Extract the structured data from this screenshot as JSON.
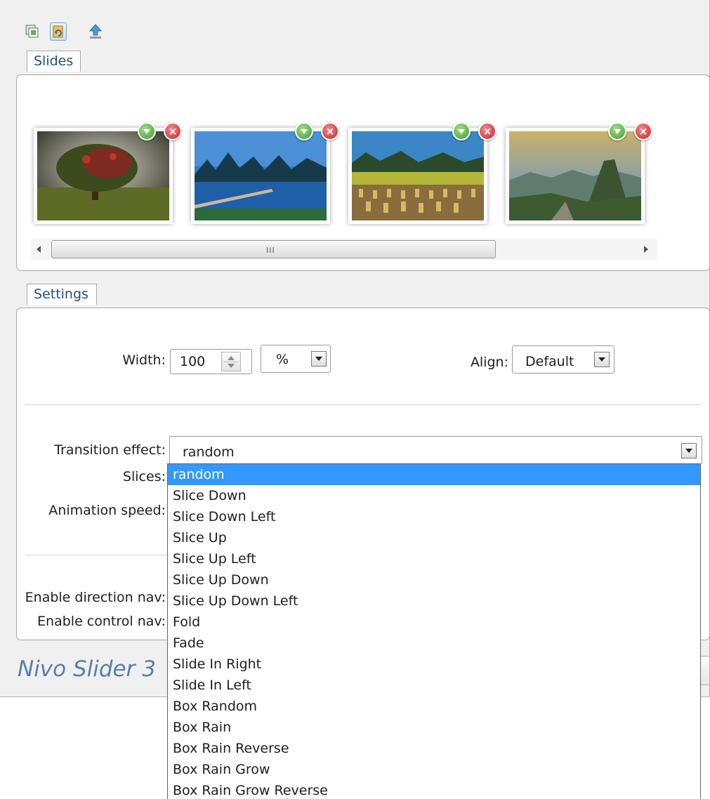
{
  "app": {
    "title": "Nivo Slider 3",
    "toolbar": {
      "icons": [
        "slides-copy-icon",
        "refresh-image-icon",
        "upload-icon"
      ]
    },
    "slides_tab": {
      "label": "Slides"
    },
    "slides": [
      {
        "image": "tree-landscape-thumbnail",
        "move_icon": "move-down-icon",
        "remove_icon": "remove-icon"
      },
      {
        "image": "lake-mountains-thumbnail",
        "move_icon": "move-down-icon",
        "remove_icon": "remove-icon"
      },
      {
        "image": "rice-field-thumbnail",
        "move_icon": "move-down-icon",
        "remove_icon": "remove-icon"
      },
      {
        "image": "mountain-peak-thumbnail",
        "move_icon": "move-down-icon",
        "remove_icon": "remove-icon"
      }
    ],
    "scrollbar": {
      "grip": "III"
    },
    "settings_tab": {
      "label": "Settings"
    },
    "settings": {
      "width_label": "Width:",
      "width_value": "100",
      "width_unit": "%",
      "align_label": "Align:",
      "align_value": "Default",
      "transition_label": "Transition effect:",
      "transition_value": "random",
      "slices_label": "Slices:",
      "animation_speed_label": "Animation speed:",
      "direction_nav_label": "Enable direction nav:",
      "control_nav_label": "Enable control nav:"
    },
    "transition_options": [
      "random",
      "Slice Down",
      "Slice Down Left",
      "Slice Up",
      "Slice Up Left",
      "Slice Up Down",
      "Slice Up Down Left",
      "Fold",
      "Fade",
      "Slide In Right",
      "Slide In Left",
      "Box Random",
      "Box Rain",
      "Box Rain Reverse",
      "Box Rain Grow",
      "Box Rain Grow Reverse"
    ],
    "selected_option_index": 0,
    "colors": {
      "selection": "#3399ff",
      "tab_text": "#264e7a",
      "title_text": "#5b7ea8"
    }
  }
}
